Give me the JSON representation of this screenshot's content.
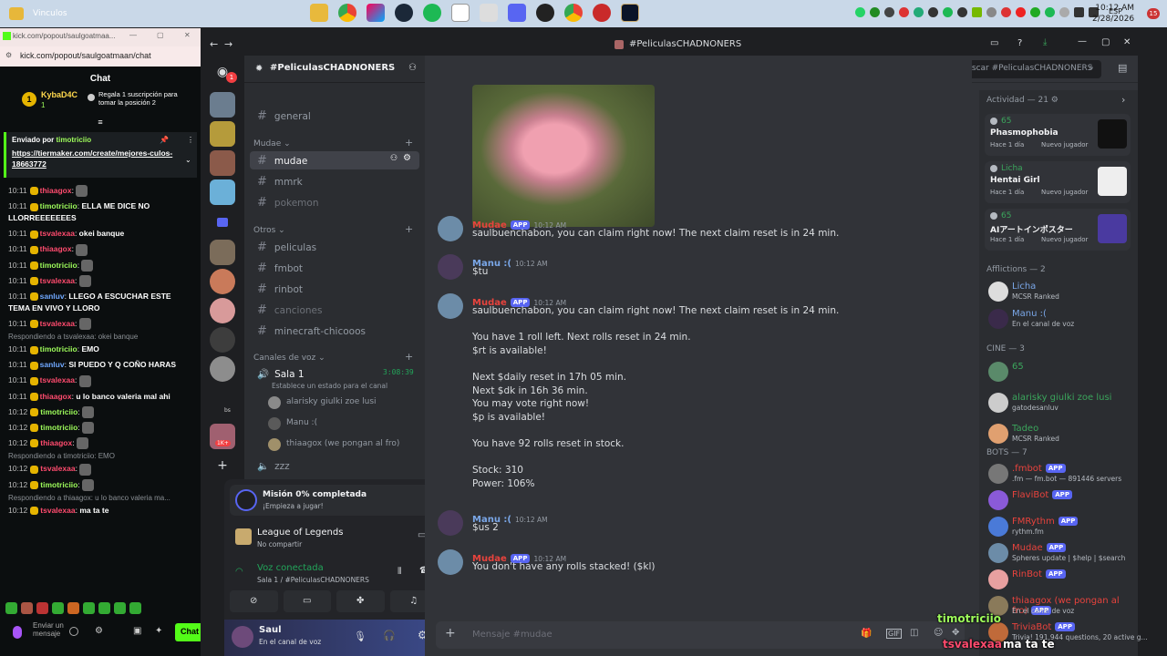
{
  "taskbar": {
    "window_label": "Vinculos",
    "lang": "ESP",
    "time": "10:12 AM",
    "date": "2/28/2026",
    "notif_count": "15",
    "apps": [
      "folder",
      "chrome",
      "colors",
      "steam",
      "spotify",
      "calendar",
      "photos",
      "discord",
      "obs",
      "chrome2",
      "record",
      "league"
    ],
    "colors": {
      "discord": "#5865f2",
      "spotify": "#1db954",
      "steam": "#1b2838"
    }
  },
  "kick": {
    "url_short": "kick.com/popout/saulgoatmaa...",
    "url": "kick.com/popout/saulgoatmaan/chat",
    "chat_title": "Chat",
    "top_user": "KybaD4C",
    "top_count": "1",
    "gift_text": "Regala 1 suscripción para tomar la posición 2",
    "pinned_by_label": "Enviado por",
    "pinned_by": "timotriciio",
    "pinned_link": "https://tiermaker.com/create/mejores-culos-18663772",
    "messages": [
      {
        "time": "10:11",
        "user": "thiaagox",
        "color": "#ff4b6e",
        "text": ""
      },
      {
        "time": "10:11",
        "user": "timotriciio",
        "color": "#9efc5b",
        "text": "ELLA ME DICE NO LLORREEEEEEES"
      },
      {
        "time": "10:11",
        "user": "tsvalexaa",
        "color": "#ff4b6e",
        "text": "okei banque"
      },
      {
        "time": "10:11",
        "user": "thiaagox",
        "color": "#ff4b6e",
        "text": ""
      },
      {
        "time": "10:11",
        "user": "timotriciio",
        "color": "#9efc5b",
        "text": ""
      },
      {
        "time": "10:11",
        "user": "tsvalexaa",
        "color": "#ff4b6e",
        "text": ""
      },
      {
        "time": "10:11",
        "user": "sanluv",
        "color": "#6fa8ff",
        "text": "LLEGO A ESCUCHAR ESTE TEMA EN VIVO Y LLORO"
      },
      {
        "time": "10:11",
        "user": "tsvalexaa",
        "color": "#ff4b6e",
        "text": ""
      },
      {
        "reply": "Respondiendo a tsvalexaa: okei banque",
        "time": "10:11",
        "user": "timotriciio",
        "color": "#9efc5b",
        "text": "EMO"
      },
      {
        "time": "10:11",
        "user": "sanluv",
        "color": "#6fa8ff",
        "text": "SI PUEDO Y Q COÑO HARAS"
      },
      {
        "time": "10:11",
        "user": "tsvalexaa",
        "color": "#ff4b6e",
        "text": ""
      },
      {
        "time": "10:11",
        "user": "thiaagox",
        "color": "#ff4b6e",
        "text": "u lo banco valeria mal ahi"
      },
      {
        "time": "10:12",
        "user": "timotriciio",
        "color": "#9efc5b",
        "text": ""
      },
      {
        "time": "10:12",
        "user": "timotriciio",
        "color": "#9efc5b",
        "text": ""
      },
      {
        "time": "10:12",
        "user": "thiaagox",
        "color": "#ff4b6e",
        "text": ""
      },
      {
        "reply": "Respondiendo a timotriciio: EMO",
        "time": "10:12",
        "user": "tsvalexaa",
        "color": "#ff4b6e",
        "text": ""
      },
      {
        "time": "10:12",
        "user": "timotriciio",
        "color": "#9efc5b",
        "text": ""
      },
      {
        "reply": "Respondiendo a thiaagox: u lo banco valeria ma...",
        "time": "10:12",
        "user": "tsvalexaa",
        "color": "#ff4b6e",
        "text": "ma ta te"
      }
    ],
    "input_placeholder": "Enviar un mensaje",
    "chat_button": "Chat",
    "brand_color": "#53fc18"
  },
  "discord": {
    "window_title": "#PeliculasCHADNONERS",
    "guild_badge": "1",
    "server_name": "#PeliculasCHADNONERS",
    "channel_name": "mudae",
    "search_placeholder": "Buscar #PeliculasCHADNONERS",
    "channels": {
      "general": "general",
      "cat_mudae": "Mudae",
      "mudae": "mudae",
      "mmrk": "mmrk",
      "pokemon": "pokemon",
      "cat_otros": "Otros",
      "peliculas": "peliculas",
      "fmbot": "fmbot",
      "rinbot": "rinbot",
      "canciones": "canciones",
      "minecraft": "minecraft-chicooos",
      "cat_voz": "Canales de voz",
      "sala": "Sala 1",
      "sala_timer": "3:08:39",
      "sala_status": "Establece un estado para el canal",
      "voice_users": [
        "alarisky giulki zoe lusi",
        "Manu :(",
        "thiaagox (we pongan al fro)"
      ],
      "zzz": "zzz"
    },
    "guild_labels": {
      "bs": "bs",
      "count": "1K+"
    },
    "mission_title": "Misión 0% completada",
    "mission_sub": "¡Empieza a jugar!",
    "game_title": "League of Legends",
    "game_sub": "No compartir",
    "voice_title": "Voz conectada",
    "voice_sub": "Sala 1 / #PeliculasCHADNONERS",
    "user_name": "Saul",
    "user_status": "En el canal de voz",
    "messages": [
      {
        "author": "Mudae",
        "color": "#e8433d",
        "app": "APP",
        "time": "10:12 AM",
        "lines": [
          "saulbuenchabon, you can claim right now! The next claim reset is in 24 min."
        ]
      },
      {
        "author": "Manu :(",
        "color": "#7aa7e8",
        "time": "10:12 AM",
        "lines": [
          "$tu"
        ]
      },
      {
        "author": "Mudae",
        "color": "#e8433d",
        "app": "APP",
        "time": "10:12 AM",
        "lines": [
          "saulbuenchabon, you can claim right now! The next claim reset is in 24 min.",
          "",
          "You have 1 roll left. Next rolls reset in 24 min.",
          "$rt is available!",
          "",
          "Next $daily reset in 17h 05 min.",
          "Next $dk in 16h 36 min.",
          "You may vote right now!",
          "$p is available!",
          "",
          "You have 92 rolls reset in stock.",
          "",
          "Stock: 310",
          "Power: 106%"
        ]
      },
      {
        "author": "Manu :(",
        "color": "#7aa7e8",
        "time": "10:12 AM",
        "lines": [
          "$us 2"
        ]
      },
      {
        "author": "Mudae",
        "color": "#e8433d",
        "app": "APP",
        "time": "10:12 AM",
        "lines": [
          "You don't have any rolls stacked! ($kl)"
        ]
      }
    ],
    "composer_placeholder": "Mensaje #mudae",
    "members": {
      "activity_title": "Actividad — 21",
      "activities": [
        {
          "user": "65",
          "game": "Phasmophobia",
          "when": "Hace 1 día",
          "badge": "Nuevo jugador"
        },
        {
          "user": "Licha",
          "game": "Hentai Girl",
          "when": "Hace 1 día",
          "badge": "Nuevo jugador"
        },
        {
          "user": "65",
          "game": "AIアートインポスター",
          "when": "Hace 1 día",
          "badge": "Nuevo jugador"
        }
      ],
      "afflictions_title": "Afflictions — 2",
      "afflictions": [
        {
          "name": "Licha",
          "color": "#7aa7e8",
          "sub": "MCSR Ranked"
        },
        {
          "name": "Manu :(",
          "color": "#7aa7e8",
          "sub": "En el canal de voz"
        }
      ],
      "cine_title": "CINE — 3",
      "cine": [
        {
          "name": "65",
          "color": "#3ba55c",
          "sub": ""
        },
        {
          "name": "alarisky giulki zoe lusi",
          "color": "#3ba55c",
          "sub": "gatodesanluv"
        },
        {
          "name": "Tadeo",
          "color": "#3ba55c",
          "sub": "MCSR Ranked"
        }
      ],
      "bots_title": "BOTS — 7",
      "bots": [
        {
          "name": ".fmbot",
          "color": "#e8433d",
          "sub": ".fm — fm.bot — 891446 servers"
        },
        {
          "name": "FlaviBot",
          "color": "#e8433d",
          "sub": ""
        },
        {
          "name": "FMRythm",
          "color": "#e8433d",
          "sub": "rythm.fm"
        },
        {
          "name": "Mudae",
          "color": "#e8433d",
          "sub": "Spheres update | $help | $search"
        },
        {
          "name": "RinBot",
          "color": "#e8433d",
          "sub": ""
        },
        {
          "name": "thiaagox (we pongan al fro)",
          "color": "#e8433d",
          "sub": "En el canal de voz"
        },
        {
          "name": "TriviaBot",
          "color": "#e8433d",
          "sub": "Trivia! 191,944 questions, 20 active g..."
        }
      ]
    }
  },
  "overlay": {
    "user1": "timotriciio",
    "user2": "tsvalexaa",
    "text2": "ma ta te"
  }
}
